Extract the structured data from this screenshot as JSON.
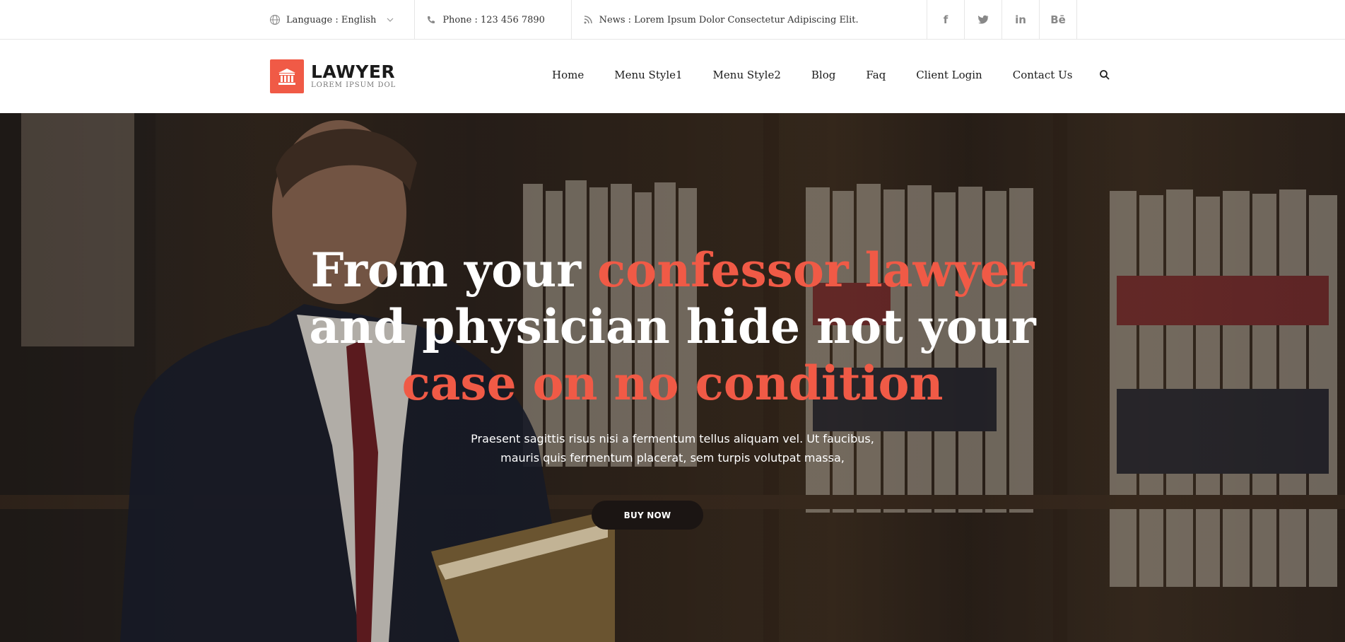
{
  "topbar": {
    "language": "Language : English",
    "phone": "Phone : 123 456 7890",
    "news": "News : Lorem Ipsum Dolor Consectetur Adipiscing Elit.",
    "social": [
      {
        "icon": "facebook-icon",
        "glyph": "f"
      },
      {
        "icon": "twitter-icon",
        "glyph": "t"
      },
      {
        "icon": "linkedin-icon",
        "glyph": "in"
      },
      {
        "icon": "behance-icon",
        "glyph": "Bē"
      }
    ]
  },
  "header": {
    "logo_title": "LAWYER",
    "logo_subtitle": "LOREM IPSUM DOL",
    "nav": [
      "Home",
      "Menu Style1",
      "Menu Style2",
      "Blog",
      "Faq",
      "Client Login",
      "Contact Us"
    ]
  },
  "hero": {
    "title_line1_white": "From your ",
    "title_line1_accent": "confessor lawyer",
    "title_line2": "and physician hide not your",
    "title_line3_accent": "case on no condition",
    "desc_line1": "Praesent sagittis risus nisi a fermentum tellus aliquam vel. Ut faucibus,",
    "desc_line2": "mauris quis fermentum placerat, sem turpis volutpat massa,",
    "button": "BUY NOW"
  },
  "colors": {
    "accent": "#f05a46",
    "button_bg": "#1b1513"
  }
}
